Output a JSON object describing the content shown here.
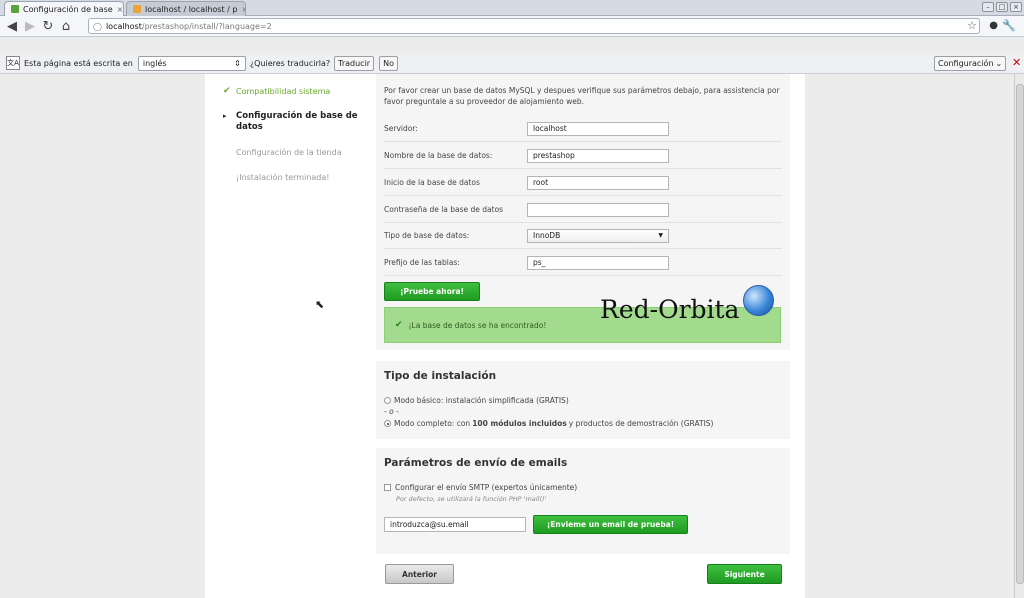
{
  "browser": {
    "tabs": [
      {
        "title": "Configuración de base",
        "active": true
      },
      {
        "title": "localhost / localhost / p",
        "active": false
      }
    ],
    "url_host": "localhost",
    "url_path": "/prestashop/install/?language=2"
  },
  "translate_bar": {
    "label": "Esta página está escrita en",
    "language": "inglés",
    "question": "¿Quieres traducirla?",
    "translate_button": "Traducir",
    "no_button": "No",
    "options_button": "Configuración"
  },
  "steps": [
    {
      "label": "Compatibilidad sistema",
      "state": "done"
    },
    {
      "label": "Configuración de base de datos",
      "state": "current"
    },
    {
      "label": "Configuración de la tienda",
      "state": "todo"
    },
    {
      "label": "¡Instalación terminada!",
      "state": "todo"
    }
  ],
  "db": {
    "intro": "Por favor crear un base de datos MySQL y despues verifique sus parámetros debajo, para assistencia por favor preguntale a su proveedor de alojamiento web.",
    "fields": [
      {
        "label": "Servidor:",
        "value": ""
      },
      {
        "label": "Nombre de la base de datos:",
        "value": "prestashop"
      },
      {
        "label": "Inicio de la base de datos",
        "value": "root"
      },
      {
        "label": "Contraseña de la base de datos",
        "value": ""
      },
      {
        "label": "Tipo de base de datos:",
        "value": "InnoDB"
      },
      {
        "label": "Prefijo de las tablas:",
        "value": "ps_"
      }
    ],
    "server_value": "localhost",
    "test_button": "¡Pruebe ahora!",
    "success_message": "¡La base de datos se ha encontrado!",
    "watermark": "Red-Orbita"
  },
  "install": {
    "title": "Tipo de instalación",
    "basic_label": "Modo básico: instalación simplificada (GRATIS)",
    "or_label": "- o -",
    "full_prefix": "Modo completo: con ",
    "full_bold": "100 módulos incluidos",
    "full_suffix": " y productos de demostración (GRATIS)"
  },
  "email": {
    "title": "Parámetros de envío de emails",
    "smtp_label": "Configurar el envío SMTP (expertos únicamente)",
    "smtp_hint": "Por defecto, se utilizará la función PHP 'mail()'",
    "email_value": "introduzca@su.email",
    "send_button": "¡Envieme un email de prueba!"
  },
  "nav": {
    "prev_button": "Anterior",
    "next_button": "Siguiente"
  }
}
